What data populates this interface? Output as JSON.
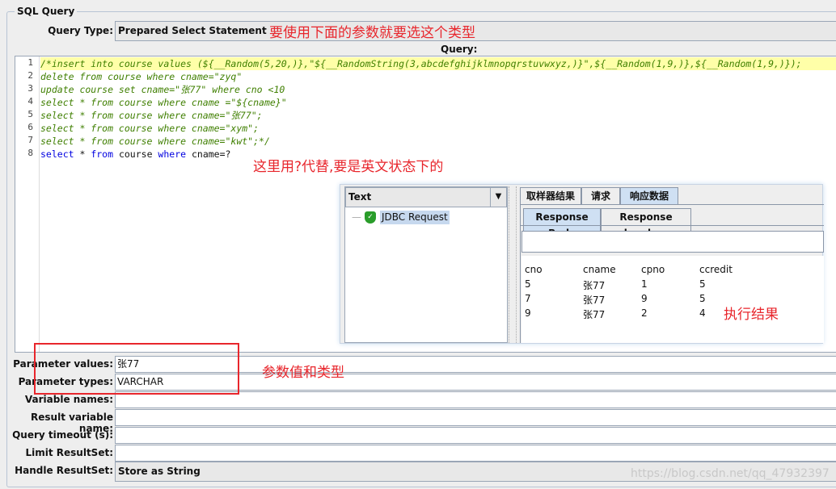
{
  "group_title": "SQL Query",
  "query_type": {
    "label": "Query Type:",
    "value": "Prepared Select Statement"
  },
  "query_label": "Query:",
  "editor": {
    "lines": [
      {
        "n": "1",
        "text": "/*insert into course values (${__Random(5,20,)},\"${__RandomString(3,abcdefghijklmnopqrstuvwxyz,)}\",${__Random(1,9,)},${__Random(1,9,)});"
      },
      {
        "n": "2",
        "text": "delete from course where cname=\"zyq\""
      },
      {
        "n": "3",
        "text": "update course set cname=\"张77\" where cno <10"
      },
      {
        "n": "4",
        "text": "select * from course where cname =\"${cname}\""
      },
      {
        "n": "5",
        "text": "select * from course where cname=\"张77\";"
      },
      {
        "n": "6",
        "text": "select * from course where cname=\"xym\";"
      },
      {
        "n": "7",
        "text": "select * from course where cname=\"kwt\";*/"
      },
      {
        "n": "8",
        "parts": [
          "select",
          " * ",
          "from",
          " course ",
          "where",
          " cname=?"
        ]
      }
    ]
  },
  "annotations": {
    "query_type_note": "要使用下面的参数就要选这个类型",
    "placeholder_note": "这里用?代替,要是英文状态下的",
    "result_note": "执行结果",
    "param_note": "参数值和类型"
  },
  "result_panel": {
    "renderer": "Text",
    "tree_item": "JDBC Request",
    "tabs": [
      "取样器结果",
      "请求",
      "响应数据"
    ],
    "subtabs": [
      "Response Body",
      "Response headers"
    ],
    "search_value": "",
    "columns": [
      "cno",
      "cname",
      "cpno",
      "ccredit"
    ],
    "rows": [
      [
        "5",
        "张77",
        "1",
        "5"
      ],
      [
        "7",
        "张77",
        "9",
        "5"
      ],
      [
        "9",
        "张77",
        "2",
        "4"
      ]
    ]
  },
  "form": {
    "param_values": {
      "label": "Parameter values:",
      "value": "张77"
    },
    "param_types": {
      "label": "Parameter types:",
      "value": "VARCHAR"
    },
    "variable_names": {
      "label": "Variable names:",
      "value": ""
    },
    "result_variable": {
      "label": "Result variable name:",
      "value": ""
    },
    "query_timeout": {
      "label": "Query timeout (s):",
      "value": ""
    },
    "limit_resultset": {
      "label": "Limit ResultSet:",
      "value": ""
    },
    "handle_resultset": {
      "label": "Handle ResultSet:",
      "value": "Store as String"
    }
  },
  "watermark": "https://blog.csdn.net/qq_47932397",
  "colors": {
    "annotation": "#e8262c",
    "comment": "#3f7f00",
    "keyword": "#0000e0",
    "selected_tab": "#cfe0f3"
  }
}
